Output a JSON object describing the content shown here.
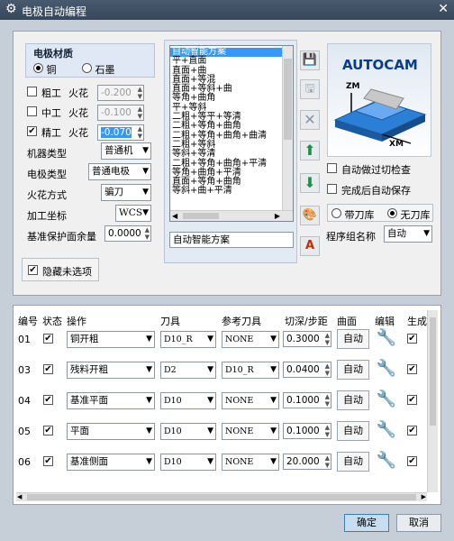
{
  "window": {
    "title": "电极自动编程"
  },
  "material": {
    "title": "电极材质",
    "options": [
      "铜",
      "石墨"
    ],
    "selected": 0
  },
  "spark": {
    "rough": {
      "label": "粗工",
      "spark_label": "火花",
      "value": "-0.200",
      "checked": false
    },
    "medium": {
      "label": "中工",
      "spark_label": "火花",
      "value": "-0.100",
      "checked": false
    },
    "fine": {
      "label": "精工",
      "spark_label": "火花",
      "value": "-0.070",
      "checked": true
    }
  },
  "settings": [
    {
      "label": "机器类型",
      "value": "普通机"
    },
    {
      "label": "电极类型",
      "value": "普通电极"
    },
    {
      "label": "火花方式",
      "value": "骗刀"
    },
    {
      "label": "加工坐标",
      "value": "WCS"
    },
    {
      "label": "基准保护面余量",
      "value": "0.0000"
    }
  ],
  "hide_unselected": {
    "label": "隐藏未选项",
    "checked": true
  },
  "schemes": {
    "items": [
      "自动智能方案",
      "平+直面",
      "直面+曲",
      "直面+等混",
      "直面+等斜+曲",
      "等角+曲角",
      "平+等斜",
      "二粗+等平+等清",
      "二粗+等角+曲角",
      "二粗+等角+曲角+曲清",
      "二粗+等斜",
      "等斜+等清",
      "二粗+等角+曲角+平清",
      "等角+曲角+平清",
      "直面+等角+曲角",
      "等斜+曲+平清"
    ],
    "selected": 0,
    "current": "自动智能方案"
  },
  "preview": {
    "brand": "AUTOCAM",
    "axis_z": "ZM",
    "axis_x": "XM"
  },
  "options": {
    "auto_overcut": {
      "label": "自动做过切检查",
      "checked": false
    },
    "auto_save": {
      "label": "完成后自动保存",
      "checked": false
    },
    "tool_lib": [
      "带刀库",
      "无刀库"
    ],
    "tool_lib_selected": 1,
    "group_label": "程序组名称",
    "group_value": "自动"
  },
  "table": {
    "headers": [
      "编号",
      "状态",
      "操作",
      "刀具",
      "参考刀具",
      "切深/步距",
      "曲面",
      "编辑",
      "生成"
    ],
    "rows": [
      {
        "no": "01",
        "op": "铜开粗",
        "tool": "D10_R",
        "ref": "NONE",
        "step": "0.3000",
        "surf": "自动"
      },
      {
        "no": "03",
        "op": "残料开粗",
        "tool": "D2",
        "ref": "D10_R",
        "step": "0.0400",
        "surf": "自动"
      },
      {
        "no": "04",
        "op": "基准平面",
        "tool": "D10",
        "ref": "NONE",
        "step": "0.1000",
        "surf": "自动"
      },
      {
        "no": "05",
        "op": "平面",
        "tool": "D10",
        "ref": "NONE",
        "step": "0.1000",
        "surf": "自动"
      },
      {
        "no": "06",
        "op": "基准侧面",
        "tool": "D10",
        "ref": "NONE",
        "step": "20.000",
        "surf": "自动"
      }
    ]
  },
  "footer": {
    "ok": "确定",
    "cancel": "取消"
  },
  "icons": {
    "gear": "gear-icon",
    "close": "close-icon",
    "save": "save-icon",
    "save_as": "save-as-icon",
    "delete": "delete-icon",
    "up": "arrow-up-icon",
    "down": "arrow-down-icon",
    "palette": "palette-icon",
    "text": "text-icon",
    "wrench": "wrench-icon"
  },
  "colors": {
    "accent": "#3399ff",
    "title_bg": "#3c4d62",
    "arrow_green": "#1f8f4a"
  }
}
